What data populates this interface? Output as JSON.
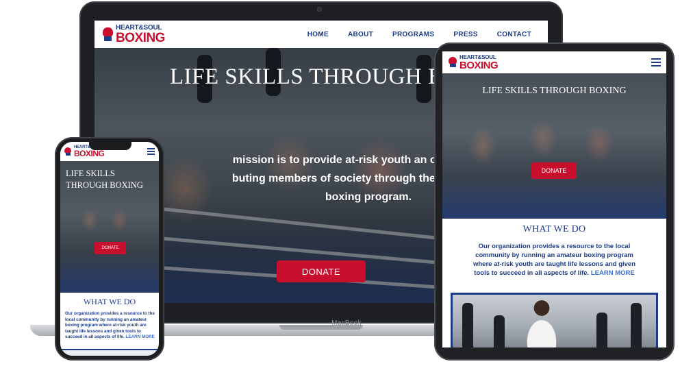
{
  "logo": {
    "top_text": "HEART&SOUL",
    "bottom_text": "BOXING",
    "icon": "boxing-glove-icon"
  },
  "colors": {
    "brand_navy": "#1b3a8a",
    "brand_red": "#c8102e",
    "link_blue": "#3a6fcf"
  },
  "laptop": {
    "brand_label": "MacBook",
    "nav": [
      "HOME",
      "ABOUT",
      "PROGRAMS",
      "PRESS",
      "CONTACT"
    ],
    "hero_title": "LIFE SKILLS THROUGH BOX",
    "mission_lines": [
      "mission is to provide at-risk youth an opportunity to",
      "buting members of society through their participatio",
      "boxing program."
    ],
    "donate_label": "DONATE"
  },
  "tablet": {
    "menu_icon": "hamburger-menu-icon",
    "hero_title": "LIFE SKILLS THROUGH BOXING",
    "donate_label": "DONATE",
    "what_we_do_title": "WHAT WE DO",
    "what_we_do_lines": [
      "Our organization provides a resource to the local",
      "community by running an amateur boxing program",
      "where at-risk youth are taught life lessons and given"
    ],
    "what_we_do_last_line": "tools to succeed in all aspects of life.",
    "learn_more_label": "LEARN MORE"
  },
  "phone": {
    "menu_icon": "hamburger-menu-icon",
    "hero_title_lines": [
      "LIFE SKILLS",
      "THROUGH BOXING"
    ],
    "donate_label": "DONATE",
    "what_we_do_title": "WHAT WE DO",
    "what_we_do_lines": [
      "Our organization provides a resource to the",
      "local community by running an amateur",
      "boxing program where at-risk youth are",
      "taught life lessons and given tools to"
    ],
    "what_we_do_last_line": "succeed in all aspects of life.",
    "learn_more_label": "LEARN MORE"
  }
}
